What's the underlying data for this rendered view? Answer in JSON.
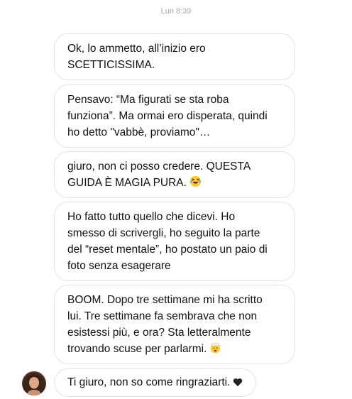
{
  "chat": {
    "timestamp": "Lun 8:39",
    "messages": [
      {
        "text": "Ok, lo ammetto, all’inizio ero\nSCETTICISSIMA.",
        "emoji": ""
      },
      {
        "text": "Pensavo: “Ma figurati se sta roba\nfunziona”. Ma ormai ero disperata, quindi\nho detto \"vabbè, proviamo\"…",
        "emoji": ""
      },
      {
        "text": "giuro,  non ci posso credere. QUESTA\nGUIDA È MAGIA PURA.",
        "emoji": "laughing-emoji"
      },
      {
        "text": "Ho fatto tutto quello che dicevi. Ho\nsmesso di scrivergli, ho seguito la parte\ndel “reset mentale”, ho postato un paio di\nfoto senza esagerare",
        "emoji": ""
      },
      {
        "text": "BOOM. Dopo tre settimane mi ha scritto\nlui. Tre settimane fa sembrava che non\nesistessi più, e ora? Sta letteralmente\ntrovando scuse per parlarmi.",
        "emoji": "exploding-head-emoji"
      },
      {
        "text": "Ti giuro, non so come ringraziarti.",
        "emoji": "black-heart-emoji"
      }
    ]
  }
}
